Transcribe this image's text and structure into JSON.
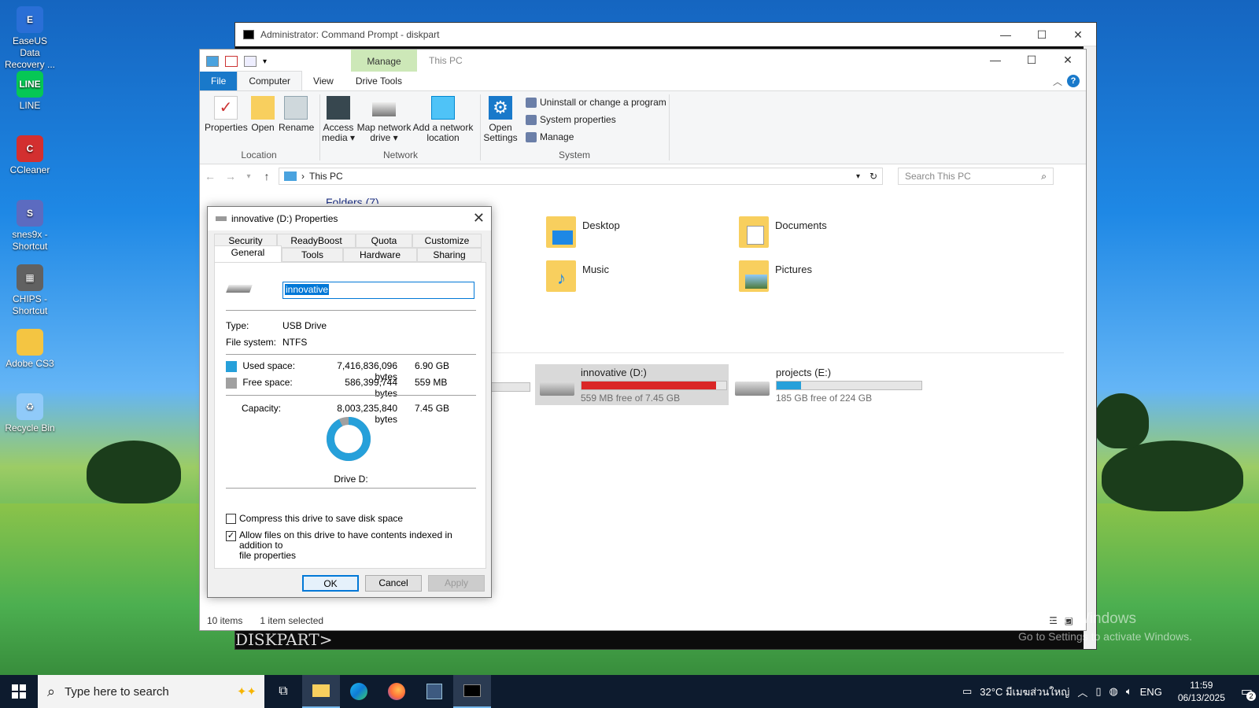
{
  "desktop": {
    "icons": [
      {
        "label1": "EaseUS Data",
        "label2": "Recovery ...",
        "color": "#2a6fd6",
        "glyph": "E"
      },
      {
        "label1": "LINE",
        "label2": "",
        "color": "#06c755",
        "glyph": "LINE"
      },
      {
        "label1": "CCleaner",
        "label2": "",
        "color": "#d32f2f",
        "glyph": "C"
      },
      {
        "label1": "snes9x -",
        "label2": "Shortcut",
        "color": "#5c6bc0",
        "glyph": "S"
      },
      {
        "label1": "CHIPS -",
        "label2": "Shortcut",
        "color": "#616161",
        "glyph": "▦"
      },
      {
        "label1": "Adobe CS3",
        "label2": "",
        "color": "#f4c542",
        "glyph": ""
      },
      {
        "label1": "Recycle Bin",
        "label2": "",
        "color": "#90caf9",
        "glyph": "♻"
      }
    ]
  },
  "cmd": {
    "title": "Administrator: Command Prompt - diskpart",
    "prompt": "DISKPART>"
  },
  "explorer": {
    "manage_tab": "Manage",
    "title": "This PC",
    "tabs": {
      "file": "File",
      "computer": "Computer",
      "view": "View",
      "drive_tools": "Drive Tools"
    },
    "ribbon": {
      "properties": "Properties",
      "open": "Open",
      "rename": "Rename",
      "location_group": "Location",
      "access_media_1": "Access",
      "access_media_2": "media ▾",
      "map_drive_1": "Map network",
      "map_drive_2": "drive ▾",
      "add_location_1": "Add a network",
      "add_location_2": "location",
      "network_group": "Network",
      "open_settings_1": "Open",
      "open_settings_2": "Settings",
      "uninstall": "Uninstall or change a program",
      "system_properties": "System properties",
      "manage": "Manage",
      "system_group": "System"
    },
    "address": "This PC",
    "search_placeholder": "Search This PC",
    "folders_header": "Folders (7)",
    "folders": [
      {
        "name": "Desktop"
      },
      {
        "name": "Documents"
      },
      {
        "name": "Music"
      },
      {
        "name": "Pictures"
      }
    ],
    "drives": [
      {
        "name": "innovative (D:)",
        "free": "559 MB free of 7.45 GB",
        "used_fraction": 0.93,
        "color": "#da2626"
      },
      {
        "name": "projects (E:)",
        "free": "185 GB free of 224 GB",
        "used_fraction": 0.17,
        "color": "#26a0da"
      }
    ],
    "status_items": "10 items",
    "status_selected": "1 item selected"
  },
  "props": {
    "title": "innovative (D:) Properties",
    "tabs_row1": [
      "Security",
      "ReadyBoost",
      "Quota",
      "Customize"
    ],
    "tabs_row2": [
      "General",
      "Tools",
      "Hardware",
      "Sharing"
    ],
    "name_value": "innovative",
    "type_label": "Type:",
    "type_value": "USB Drive",
    "fs_label": "File system:",
    "fs_value": "NTFS",
    "used_label": "Used space:",
    "used_bytes": "7,416,836,096 bytes",
    "used_gb": "6.90 GB",
    "free_label": "Free space:",
    "free_bytes": "586,399,744 bytes",
    "free_gb": "559 MB",
    "cap_label": "Capacity:",
    "cap_bytes": "8,003,235,840 bytes",
    "cap_gb": "7.45 GB",
    "used_fraction": 0.927,
    "used_color": "#26a0da",
    "free_color": "#a0a0a0",
    "drive_label": "Drive D:",
    "compress_label": "Compress this drive to save disk space",
    "index_label_1": "Allow files on this drive to have contents indexed in addition to",
    "index_label_2": "file properties",
    "ok": "OK",
    "cancel": "Cancel",
    "apply": "Apply"
  },
  "taskbar": {
    "search_placeholder": "Type here to search",
    "weather": "32°C มีเมฆส่วนใหญ่",
    "lang": "ENG",
    "time": "11:59",
    "date": "06/13/2025",
    "notifications": "2"
  },
  "watermark": {
    "line1": "Activate Windows",
    "line2": "Go to Settings to activate Windows."
  }
}
